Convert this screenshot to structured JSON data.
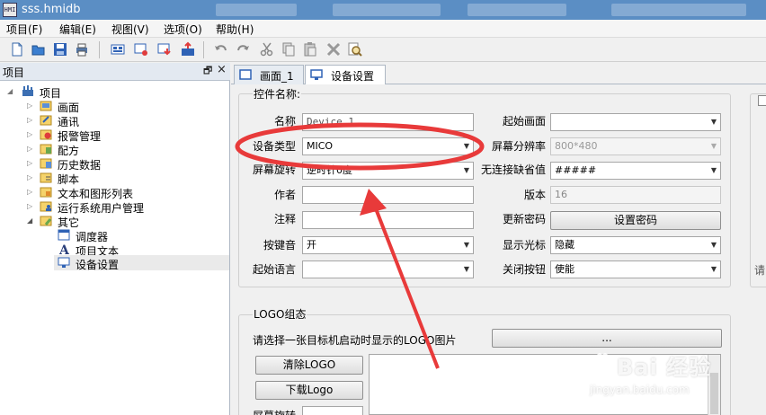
{
  "app": {
    "title": "sss.hmidb",
    "icon_text": "HMI"
  },
  "menu": [
    {
      "label": "项目(F)"
    },
    {
      "label": "编辑(E)"
    },
    {
      "label": "视图(V)"
    },
    {
      "label": "选项(O)"
    },
    {
      "label": "帮助(H)"
    }
  ],
  "toolbar": {
    "icons": [
      "new-file-icon",
      "open-folder-icon",
      "save-icon",
      "print-icon",
      "compile-icon",
      "simulate-icon",
      "download-icon",
      "upload-icon",
      "undo-icon",
      "redo-icon",
      "cut-icon",
      "copy-icon",
      "paste-icon",
      "delete-icon",
      "find-icon"
    ]
  },
  "project_panel": {
    "title": "项目",
    "pin_glyph": "🗗",
    "close_glyph": "×",
    "root": "项目",
    "items": [
      {
        "label": "画面",
        "icon": "screen-icon"
      },
      {
        "label": "通讯",
        "icon": "communication-icon"
      },
      {
        "label": "报警管理",
        "icon": "alarm-icon"
      },
      {
        "label": "配方",
        "icon": "recipe-icon"
      },
      {
        "label": "历史数据",
        "icon": "history-icon"
      },
      {
        "label": "脚本",
        "icon": "script-icon"
      },
      {
        "label": "文本和图形列表",
        "icon": "text-graphic-list-icon"
      },
      {
        "label": "运行系统用户管理",
        "icon": "user-management-icon"
      },
      {
        "label": "其它",
        "icon": "other-folder-icon"
      }
    ],
    "other_children": [
      {
        "label": "调度器",
        "icon": "scheduler-icon"
      },
      {
        "label": "项目文本",
        "icon": "project-text-icon"
      },
      {
        "label": "设备设置",
        "icon": "device-settings-icon",
        "selected": true
      }
    ]
  },
  "tabs": [
    {
      "label": "画面_1",
      "active": false
    },
    {
      "label": "设备设置",
      "active": true
    }
  ],
  "control_group": {
    "title": "控件名称:",
    "fields": {
      "name_label": "名称",
      "name_value": "Device_1",
      "device_type_label": "设备类型",
      "device_type_value": "MICO",
      "screen_rotation_label": "屏幕旋转",
      "screen_rotation_value": "逆时针0度",
      "author_label": "作者",
      "author_value": "",
      "comment_label": "注释",
      "comment_value": "",
      "key_sound_label": "按键音",
      "key_sound_value": "开",
      "start_language_label": "起始语言",
      "start_language_value": "",
      "start_screen_label": "起始画面",
      "start_screen_value": "",
      "resolution_label": "屏幕分辨率",
      "resolution_value": "800*480",
      "no_connection_label": "无连接缺省值",
      "no_connection_value": "#####",
      "version_label": "版本",
      "version_value": "16",
      "update_password_label": "更新密码",
      "set_password_button": "设置密码",
      "show_cursor_label": "显示光标",
      "show_cursor_value": "隐藏",
      "close_button_label": "关闭按钮",
      "close_button_value": "使能"
    }
  },
  "logo_group": {
    "title": "LOGO组态",
    "prompt": "请选择一张目标机启动时显示的LOGO图片",
    "browse_button": "...",
    "clear_button": "清除LOGO",
    "download_button": "下载Logo",
    "rotation_label": "屏幕旋转"
  },
  "right_fragment": {
    "text": "请"
  },
  "watermark": {
    "text": "Bai 经验",
    "url": "jingyan.baidu.com"
  },
  "colors": {
    "annotation_red": "#e83a3a",
    "titlebar_blue": "#5b8ec4"
  }
}
